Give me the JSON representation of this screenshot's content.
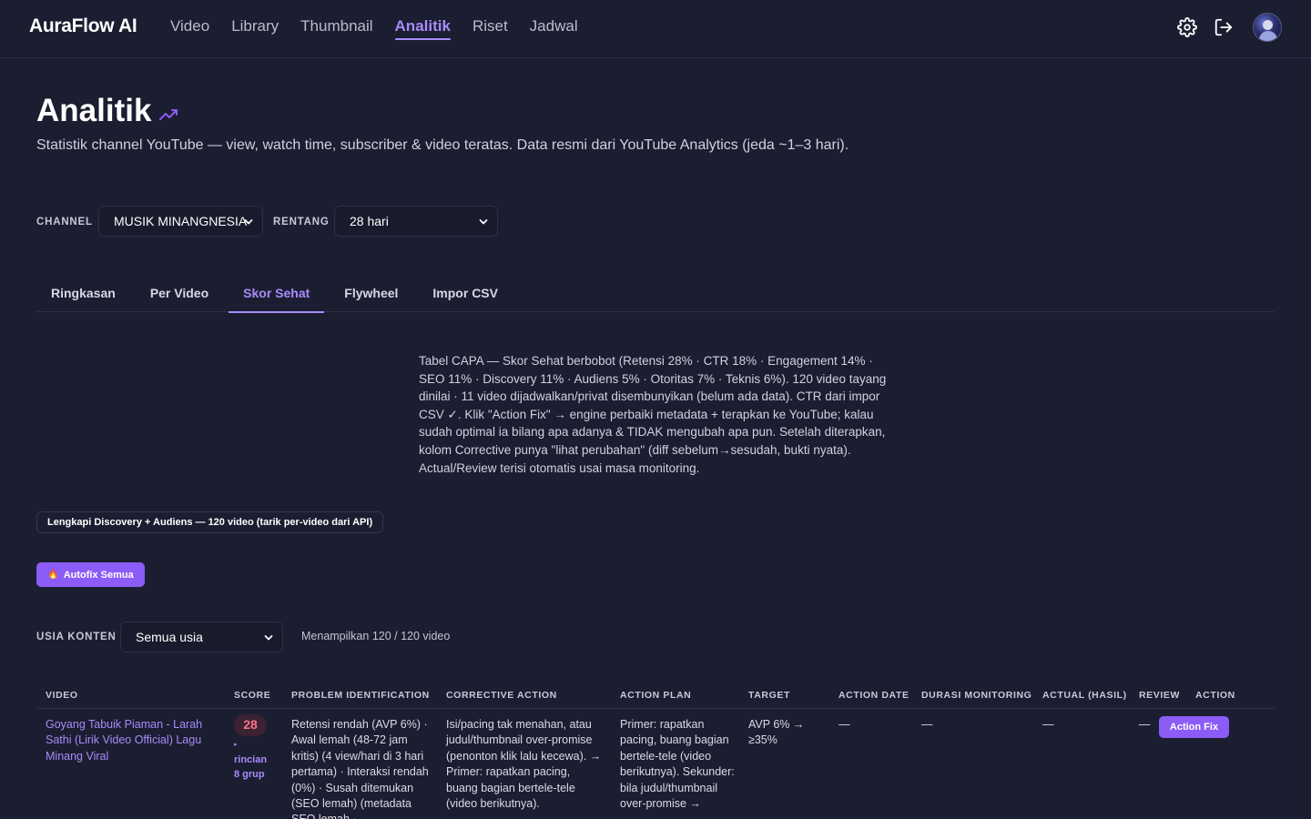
{
  "app": {
    "brand": "AuraFlow AI",
    "nav": [
      "Video",
      "Library",
      "Thumbnail",
      "Analitik",
      "Riset",
      "Jadwal"
    ],
    "active_nav": "Analitik"
  },
  "header": {
    "title": "Analitik",
    "subtitle": "Statistik channel YouTube — view, watch time, subscriber & video teratas. Data resmi dari YouTube Analytics (jeda ~1–3 hari)."
  },
  "filters": {
    "channel_label": "CHANNEL",
    "channel_value": "MUSIK MINANGNESIA",
    "range_label": "RENTANG",
    "range_value": "28 hari"
  },
  "tabs": [
    "Ringkasan",
    "Per Video",
    "Skor Sehat",
    "Flywheel",
    "Impor CSV"
  ],
  "active_tab": "Skor Sehat",
  "description": "Tabel CAPA — Skor Sehat berbobot (Retensi 28% · CTR 18% · Engagement 14% · SEO 11% · Discovery 11% · Audiens 5% · Otoritas 7% · Teknis 6%). 120 video tayang dinilai · 11 video dijadwalkan/privat disembunyikan (belum ada data). CTR dari impor CSV ✓. Klik \"Action Fix\" → engine perbaiki metadata + terapkan ke YouTube; kalau sudah optimal ia bilang apa adanya & TIDAK mengubah apa pun. Setelah diterapkan, kolom Corrective punya \"lihat perubahan\" (diff sebelum→sesudah, bukti nyata). Actual/Review terisi otomatis usai masa monitoring.",
  "actions": {
    "discovery_chip": "Lengkapi Discovery + Audiens — 120 video (tarik per-video dari API)",
    "autofix_label": "Autofix Semua",
    "autofix_icon": "🔥"
  },
  "age_filter": {
    "label": "USIA KONTEN",
    "value": "Semua usia",
    "count_text": "Menampilkan 120 / 120 video"
  },
  "table": {
    "headers": [
      "VIDEO",
      "SCORE",
      "PROBLEM IDENTIFICATION",
      "CORRECTIVE ACTION",
      "ACTION PLAN",
      "TARGET",
      "ACTION DATE",
      "DURASI MONITORING",
      "ACTUAL (HASIL)",
      "REVIEW",
      "ACTION"
    ],
    "rows": [
      {
        "video": "Goyang Tabuik Piaman - Larah Sathi (Lirik Video Official) Lagu Minang Viral",
        "score": "28",
        "score_link": "▸ rincian 8 grup",
        "problem": "Retensi rendah (AVP 6%) · Awal lemah (48-72 jam kritis) (4 view/hari di 3 hari pertama) · Interaksi rendah (0%) · Susah ditemukan (SEO lemah) (metadata SEO lemah ·",
        "corrective": "Isi/pacing tak menahan, atau judul/thumbnail over-promise (penonton klik lalu kecewa). → Primer: rapatkan pacing, buang bagian bertele-tele (video berikutnya).",
        "plan": "Primer: rapatkan pacing, buang bagian bertele-tele (video berikutnya). Sekunder: bila judul/thumbnail over-promise →",
        "target": "AVP 6% → ≥35%",
        "action_date": "—",
        "durasi": "—",
        "actual": "—",
        "review": "—",
        "action_label": "Action Fix"
      }
    ]
  },
  "colors": {
    "background": "#1b1e31",
    "accent": "#8b5cf6",
    "accent_text": "#a78bfa",
    "score_bad": "#fb7185"
  }
}
